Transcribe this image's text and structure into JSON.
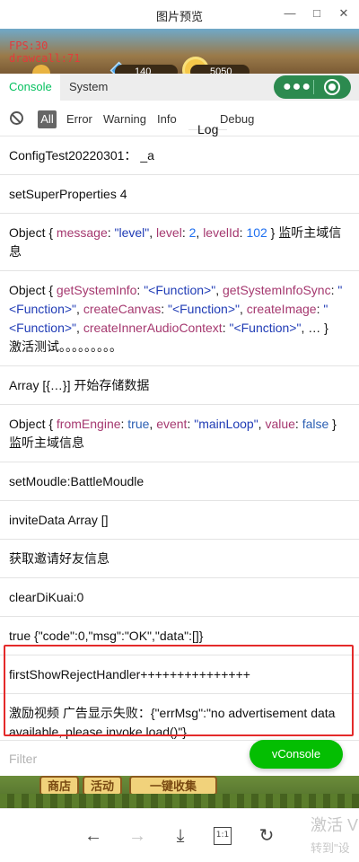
{
  "window": {
    "title": "图片预览",
    "min_icon": "minimize-icon",
    "max_icon": "maximize-icon",
    "close_icon": "close-icon"
  },
  "game_overlay": {
    "fps": "FPS:30",
    "drawcall": "drawcall:71",
    "resource_1": "140",
    "resource_2": "5050"
  },
  "vconsole": {
    "tabs": [
      "Console",
      "System"
    ],
    "active_tab": "Console",
    "accent": "#07c160",
    "filter_tabs": [
      "All",
      "Error",
      "Warning",
      "Info",
      "Log",
      "Debug"
    ],
    "active_filter": "All",
    "filter_placeholder": "Filter",
    "toggle_label": "vConsole"
  },
  "logs": [
    {
      "text": "ConfigTest20220301： _a"
    },
    {
      "text": "setSuperProperties 4"
    },
    {
      "parts": [
        "Object { ",
        "message",
        ": ",
        "\"level\"",
        ", ",
        "level",
        ": ",
        "2",
        ", ",
        "levelId",
        ": ",
        "102",
        " } 监听主域信息"
      ]
    },
    {
      "parts": [
        "Object { ",
        "getSystemInfo",
        ": ",
        "\"<Function>\"",
        ", ",
        "getSystemInfoSync",
        ": ",
        "\"<Function>\"",
        ", ",
        "createCanvas",
        ": ",
        "\"<Function>\"",
        ", ",
        "createImage",
        ": ",
        "\"<Function>\"",
        ", ",
        "createInnerAudioContext",
        ": ",
        "\"<Function>\"",
        ", … }",
        " 激活测试。。。。。。。。。"
      ]
    },
    {
      "text": "Array [{…}] 开始存储数据"
    },
    {
      "parts": [
        "Object { ",
        "fromEngine",
        ": ",
        "true",
        ", ",
        "event",
        ": ",
        "\"mainLoop\"",
        ", ",
        "value",
        ": ",
        "false",
        " } 监听主域信息"
      ]
    },
    {
      "text": "setMoudle:BattleMoudle"
    },
    {
      "text": "inviteData Array []"
    },
    {
      "text": "获取邀请好友信息"
    },
    {
      "text": "clearDiKuai:0"
    },
    {
      "text": "true {\"code\":0,\"msg\":\"OK\",\"data\":[]}"
    },
    {
      "text": "firstShowRejectHandler+++++++++++++++"
    },
    {
      "text": "激励视频 广告显示失败：{\"errMsg\":\"no advertisement data available, please invoke load()\"}"
    }
  ],
  "game_bottom": {
    "btn_1": "商店",
    "btn_2": "活动",
    "btn_3": "一键收集"
  },
  "navbar": {
    "back_icon": "arrow-left-icon",
    "forward_icon": "arrow-right-icon",
    "download_icon": "download-icon",
    "actual_size_label": "1:1",
    "rotate_icon": "rotate-icon"
  },
  "watermark": {
    "line1": "激活 V",
    "line2": "转到\"设"
  },
  "highlight_color": "#e42a2a"
}
